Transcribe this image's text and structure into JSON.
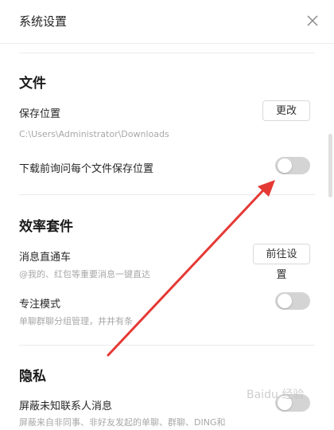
{
  "window": {
    "title": "系统设置",
    "close_icon": "close-icon"
  },
  "files": {
    "section_title": "文件",
    "save_location_label": "保存位置",
    "change_button": "更改",
    "save_path": "C:\\Users\\Administrator\\Downloads",
    "ask_before_download_label": "下载前询问每个文件保存位置",
    "ask_before_download_on": false
  },
  "efficiency": {
    "section_title": "效率套件",
    "message_express_label": "消息直通车",
    "message_express_desc": "@我的、红包等重要消息一键直达",
    "goto_settings_button": "前往设置",
    "focus_mode_label": "专注模式",
    "focus_mode_desc": "单聊群聊分组管理，井井有条",
    "focus_mode_on": false
  },
  "privacy": {
    "section_title": "隐私",
    "block_unknown_label": "屏蔽未知联系人消息",
    "block_unknown_desc": "屏蔽来自非同事、非好友发起的单聊、群聊、DING和",
    "block_unknown_on": false
  },
  "annotation": {
    "arrow_color": "#e53935"
  },
  "watermark": {
    "text": "Baidu 经验"
  }
}
